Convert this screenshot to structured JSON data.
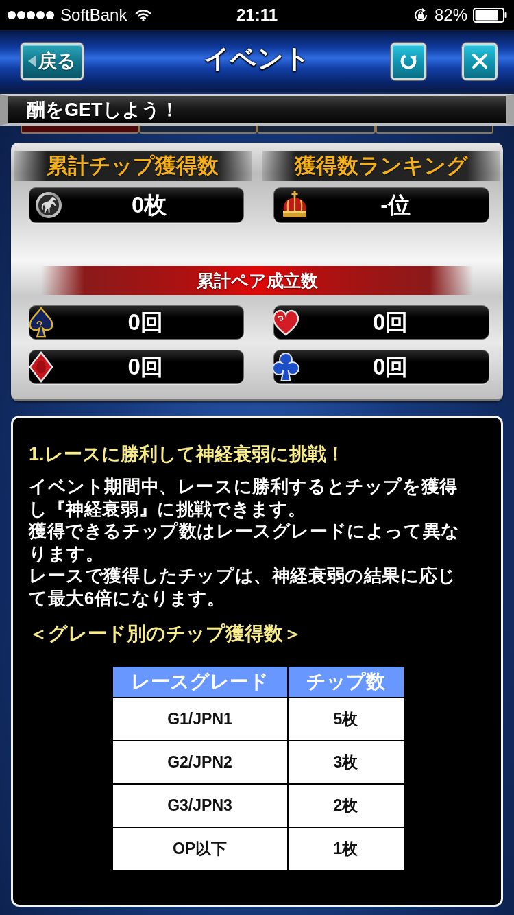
{
  "status_bar": {
    "carrier": "SoftBank",
    "time": "21:11",
    "battery": "82%"
  },
  "nav": {
    "back": "戻る",
    "title": "イベント"
  },
  "ticker": "酬をGETしよう！",
  "tab_strip": [
    {
      "selected": true
    },
    {
      "selected": false
    },
    {
      "selected": false
    },
    {
      "selected": false
    }
  ],
  "stats": {
    "totals": [
      {
        "label": "累計チップ獲得数",
        "value": "0枚"
      },
      {
        "label": "獲得数ランキング",
        "value": "-位"
      }
    ],
    "pairs_title": "累計ペア成立数",
    "pairs": [
      {
        "value": "0回"
      },
      {
        "value": "0回"
      },
      {
        "value": "0回"
      },
      {
        "value": "0回"
      }
    ]
  },
  "info": {
    "heading": "1.レースに勝利して神経衰弱に挑戦！",
    "body": [
      "イベント期間中、レースに勝利するとチップを獲得し『神経衰弱』に挑戦できます。",
      "獲得できるチップ数はレースグレードによって異なります。",
      "レースで獲得したチップは、神経衰弱の結果に応じて最大6倍になります。"
    ],
    "table_title": "＜グレード別のチップ獲得数＞",
    "table": {
      "columns": [
        "レースグレード",
        "チップ数"
      ],
      "rows": [
        [
          "G1/JPN1",
          "5枚"
        ],
        [
          "G2/JPN2",
          "3枚"
        ],
        [
          "G3/JPN3",
          "2枚"
        ],
        [
          "OP以下",
          "1枚"
        ]
      ]
    }
  }
}
